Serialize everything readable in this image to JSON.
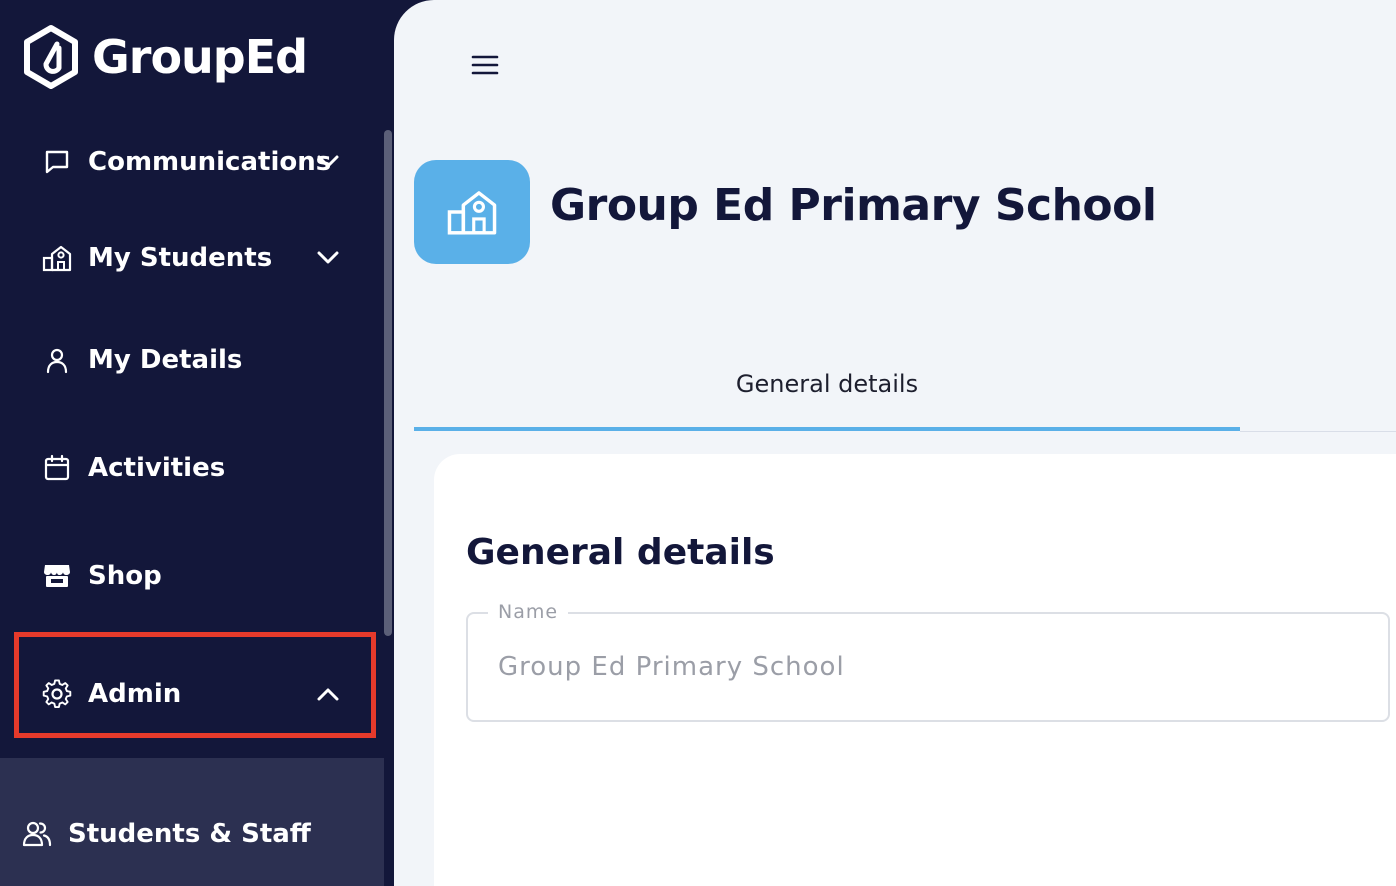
{
  "app": {
    "logo_text": "GroupEd"
  },
  "sidebar": {
    "items": [
      {
        "label": "Communications",
        "icon": "chat-bubble-icon",
        "chevron": "chevron-down-icon"
      },
      {
        "label": "My Students",
        "icon": "school-building-icon",
        "chevron": "chevron-down-icon"
      },
      {
        "label": "My Details",
        "icon": "user-icon"
      },
      {
        "label": "Activities",
        "icon": "calendar-icon"
      },
      {
        "label": "Shop",
        "icon": "storefront-icon"
      },
      {
        "label": "Admin",
        "icon": "gear-icon",
        "chevron": "chevron-up-icon",
        "expanded": true,
        "highlighted": true
      }
    ],
    "admin_submenu": [
      {
        "label": "Students & Staff",
        "icon": "users-icon"
      }
    ]
  },
  "header": {
    "menu_icon": "hamburger-menu-icon",
    "school_icon": "school-building-icon",
    "school_name": "Group Ed Primary School"
  },
  "tabs": [
    {
      "label": "General details",
      "active": true
    }
  ],
  "general_details": {
    "title": "General details",
    "name_field": {
      "label": "Name",
      "value": "Group Ed Primary School"
    }
  },
  "colors": {
    "sidebar_bg": "#13173a",
    "submenu_bg": "#2c3051",
    "main_bg": "#f2f5f9",
    "accent": "#5ab0e8",
    "highlight_border": "#e63a2b"
  }
}
